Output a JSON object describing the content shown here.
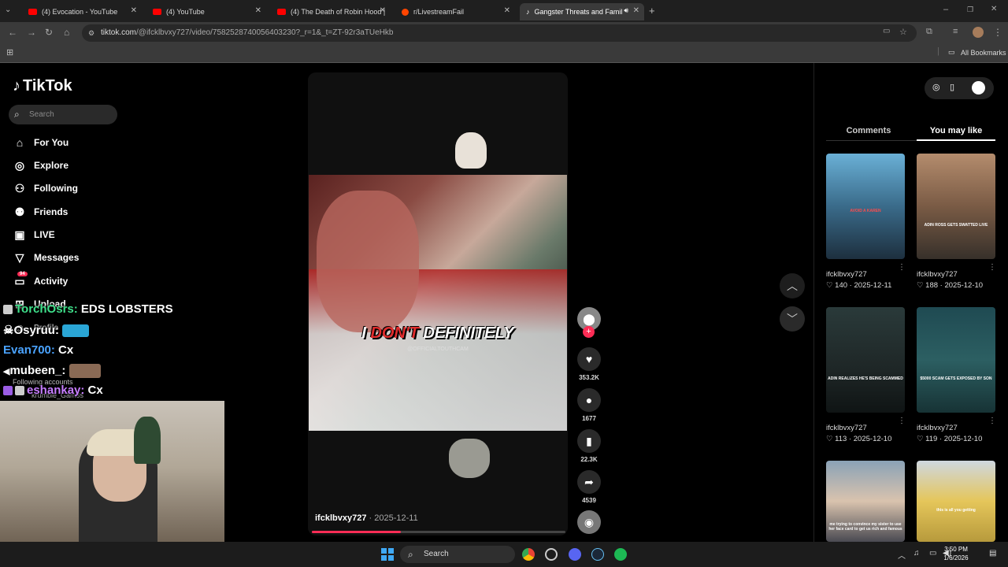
{
  "browser": {
    "tabs": [
      {
        "title": "(4) Evocation - YouTube",
        "favicon": "youtube-icon",
        "active": false
      },
      {
        "title": "(4) YouTube",
        "favicon": "youtube-icon",
        "active": false
      },
      {
        "title": "(4) The Death of Robin Hood | ",
        "favicon": "youtube-icon",
        "active": false
      },
      {
        "title": "r/LivestreamFail",
        "favicon": "reddit-icon",
        "active": false
      },
      {
        "title": "Gangster Threats and Famil",
        "favicon": "tiktok-icon",
        "active": true
      }
    ],
    "url_host": "tiktok.com",
    "url_path": "/@ifcklbvxy727/video/7582528740056403230?_r=1&_t=ZT-92r3aTUeHkb",
    "bookmarks_label": "All Bookmarks"
  },
  "tiktok": {
    "logo_text": "TikTok",
    "search_placeholder": "Search",
    "nav": [
      {
        "label": "For You",
        "icon": "home-icon"
      },
      {
        "label": "Explore",
        "icon": "compass-icon"
      },
      {
        "label": "Following",
        "icon": "following-icon"
      },
      {
        "label": "Friends",
        "icon": "friends-icon"
      },
      {
        "label": "LIVE",
        "icon": "live-icon"
      },
      {
        "label": "Messages",
        "icon": "messages-icon"
      },
      {
        "label": "Activity",
        "icon": "activity-icon",
        "badge": "94"
      },
      {
        "label": "Upload",
        "icon": "upload-icon"
      },
      {
        "label": "Profile",
        "icon": "profile-icon"
      }
    ],
    "following_accounts_label": "Following accounts",
    "following_account_1": "krumble_Gam3s"
  },
  "chat": [
    {
      "user": "TorchOsrs:",
      "message": "EDS LOBSTERS",
      "color": "#3fe08b"
    },
    {
      "user": "Osyruu:",
      "message": "",
      "color": "#ffffff"
    },
    {
      "user": "Evan700:",
      "message": "Cx",
      "color": "#4aa3ff"
    },
    {
      "user": "mubeen_:",
      "message": "",
      "color": "#ffffff"
    },
    {
      "user": "eshankay:",
      "message": "Cx",
      "color": "#c77dff"
    }
  ],
  "video": {
    "caption_red": "DON'T",
    "caption_pre": "I",
    "caption_post": "DEFINITELY",
    "watermark": "@OFFICIALTOUTHCAM",
    "author": "ifcklbvxy727",
    "date": "2025-12-11",
    "progress": 0.35,
    "likes": "353.2K",
    "comments": "1677",
    "saves": "22.3K",
    "shares": "4539",
    "accent": "#fe2c55"
  },
  "panel": {
    "tab_comments": "Comments",
    "tab_you_may_like": "You may like",
    "cards": [
      {
        "author": "ifcklbvxy727",
        "likes": "140",
        "date": "2025-12-11",
        "overlay": "AVOID A KAREN"
      },
      {
        "author": "ifcklbvxy727",
        "likes": "188",
        "date": "2025-12-10",
        "overlay": "ADIN ROSS GETS SWATTED LIVE"
      },
      {
        "author": "ifcklbvxy727",
        "likes": "113",
        "date": "2025-12-10",
        "overlay": "ADIN REALIZES HE'S BEING SCAMMED"
      },
      {
        "author": "ifcklbvxy727",
        "likes": "119",
        "date": "2025-12-10",
        "overlay": "$5000 SCAM GETS EXPOSED BY SON"
      },
      {
        "author": "",
        "likes": "",
        "date": "",
        "overlay": "me trying to convince my sister to use her face card to get us rich and famous"
      },
      {
        "author": "",
        "likes": "",
        "date": "",
        "overlay": "this is all you getting"
      }
    ]
  },
  "taskbar": {
    "search_label": "Search",
    "time": "3:50 PM",
    "date": "1/6/2026"
  }
}
